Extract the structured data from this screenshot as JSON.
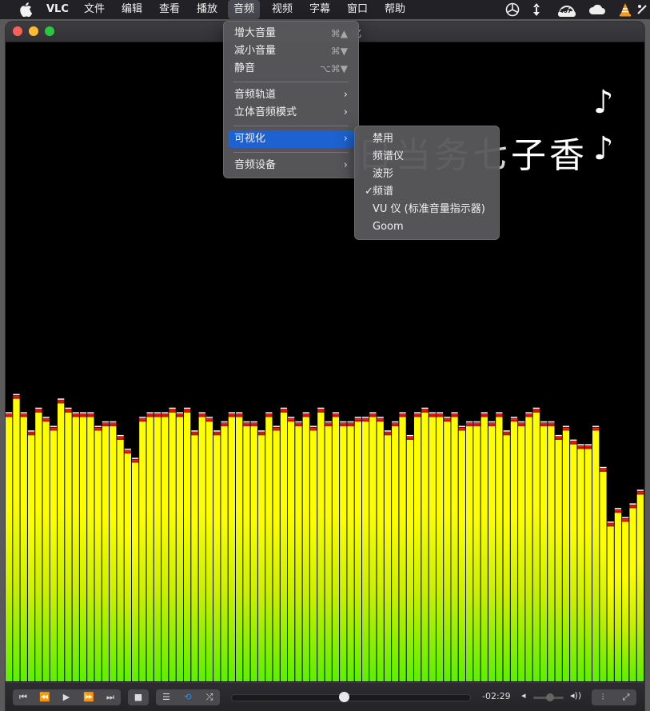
{
  "menubar": {
    "app": "VLC",
    "items": [
      "文件",
      "编辑",
      "查看",
      "播放",
      "音频",
      "视频",
      "字幕",
      "窗口",
      "帮助"
    ],
    "active": "音频",
    "badge": "407"
  },
  "window": {
    "title_fragment": "化",
    "lyric": "日当务七子香",
    "note_top": "♪",
    "note_side": "♪"
  },
  "audio_menu": {
    "items": [
      {
        "label": "增大音量",
        "shortcut": "⌘▲"
      },
      {
        "label": "减小音量",
        "shortcut": "⌘▼"
      },
      {
        "label": "静音",
        "shortcut": "⌥⌘▼"
      },
      {
        "label": "音频轨道",
        "arrow": "›"
      },
      {
        "label": "立体音频模式",
        "arrow": "›"
      },
      {
        "label": "可视化",
        "arrow": "›"
      },
      {
        "label": "音频设备",
        "arrow": "›"
      }
    ]
  },
  "viz_menu": {
    "items": [
      "禁用",
      "频谱仪",
      "波形",
      "频谱",
      "VU 仪 (标准音量指示器)",
      "Goom"
    ],
    "checked": "频谱",
    "check_glyph": "✓"
  },
  "controls": {
    "time": "-02:29",
    "seek_fraction": 0.47,
    "volume_fraction": 0.3
  },
  "spectrum": {
    "bar_levels": [
      0.58,
      0.62,
      0.58,
      0.54,
      0.59,
      0.57,
      0.55,
      0.61,
      0.59,
      0.58,
      0.58,
      0.58,
      0.55,
      0.56,
      0.56,
      0.53,
      0.5,
      0.48,
      0.57,
      0.58,
      0.58,
      0.58,
      0.59,
      0.58,
      0.59,
      0.54,
      0.58,
      0.57,
      0.54,
      0.56,
      0.58,
      0.58,
      0.56,
      0.56,
      0.54,
      0.58,
      0.55,
      0.59,
      0.57,
      0.56,
      0.58,
      0.55,
      0.59,
      0.56,
      0.58,
      0.56,
      0.56,
      0.57,
      0.57,
      0.58,
      0.57,
      0.54,
      0.56,
      0.58,
      0.53,
      0.58,
      0.59,
      0.58,
      0.58,
      0.57,
      0.58,
      0.55,
      0.56,
      0.56,
      0.58,
      0.56,
      0.58,
      0.54,
      0.57,
      0.56,
      0.58,
      0.59,
      0.56,
      0.56,
      0.53,
      0.55,
      0.52,
      0.51,
      0.51,
      0.55,
      0.46,
      0.34,
      0.37,
      0.35,
      0.38,
      0.41
    ],
    "colors": {
      "top": "#ffff00",
      "mid": "#cdf000",
      "bottom": "#5cf000",
      "peak": "#ff1a1a",
      "peak_cap": "#ffffff"
    }
  }
}
